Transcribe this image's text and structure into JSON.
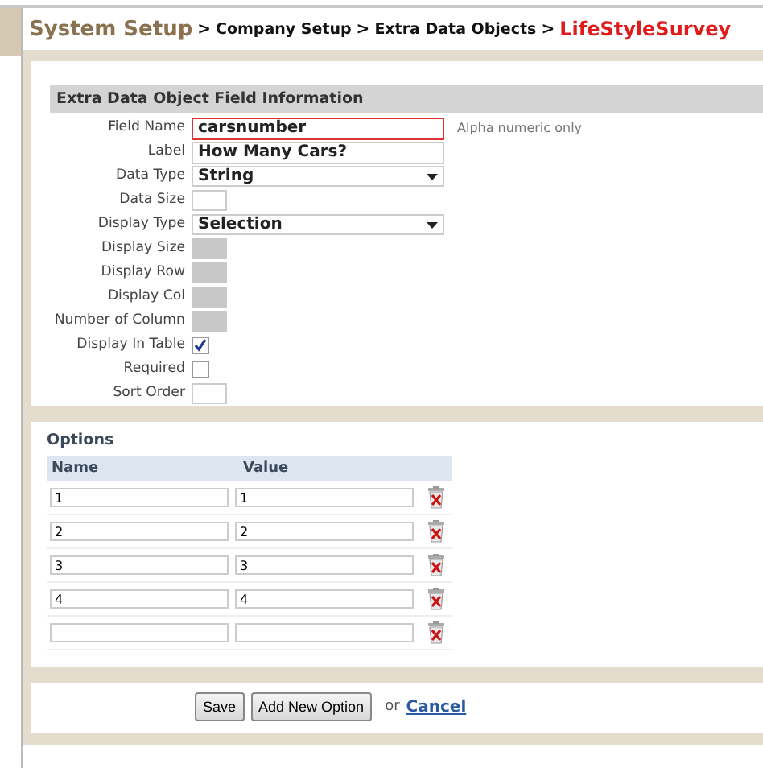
{
  "breadcrumb": {
    "separator": ">",
    "items": [
      {
        "text": "System Setup",
        "kind": "root"
      },
      {
        "text": "Company Setup",
        "kind": "link"
      },
      {
        "text": "Extra Data Objects",
        "kind": "link"
      },
      {
        "text": "LifeStyleSurvey",
        "kind": "current"
      }
    ]
  },
  "field_info": {
    "title": "Extra Data Object Field Information",
    "fields": [
      {
        "label": "Field Name",
        "kind": "text",
        "value": "carsnumber",
        "invalid": true,
        "hint": "Alpha numeric only"
      },
      {
        "label": "Label",
        "kind": "text",
        "value": "How Many Cars?",
        "invalid": false
      },
      {
        "label": "Data Type",
        "kind": "select",
        "value": "String"
      },
      {
        "label": "Data Size",
        "kind": "small",
        "disabled": false
      },
      {
        "label": "Display Type",
        "kind": "select",
        "value": "Selection"
      },
      {
        "label": "Display Size",
        "kind": "small",
        "disabled": true
      },
      {
        "label": "Display Row",
        "kind": "small",
        "disabled": true
      },
      {
        "label": "Display Col",
        "kind": "small",
        "disabled": true
      },
      {
        "label": "Number of Column",
        "kind": "small",
        "disabled": true
      },
      {
        "label": "Display In Table",
        "kind": "checkbox",
        "checked": true
      },
      {
        "label": "Required",
        "kind": "checkbox",
        "checked": false
      },
      {
        "label": "Sort Order",
        "kind": "small",
        "disabled": false
      }
    ]
  },
  "options": {
    "title": "Options",
    "columns": [
      "Name",
      "Value"
    ],
    "rows": [
      {
        "name": "1",
        "value": "1"
      },
      {
        "name": "2",
        "value": "2"
      },
      {
        "name": "3",
        "value": "3"
      },
      {
        "name": "4",
        "value": "4"
      },
      {}
    ]
  },
  "actions": {
    "buttons": [
      "Save",
      "Add New Option"
    ],
    "or_text": "or",
    "cancel": "Cancel"
  }
}
